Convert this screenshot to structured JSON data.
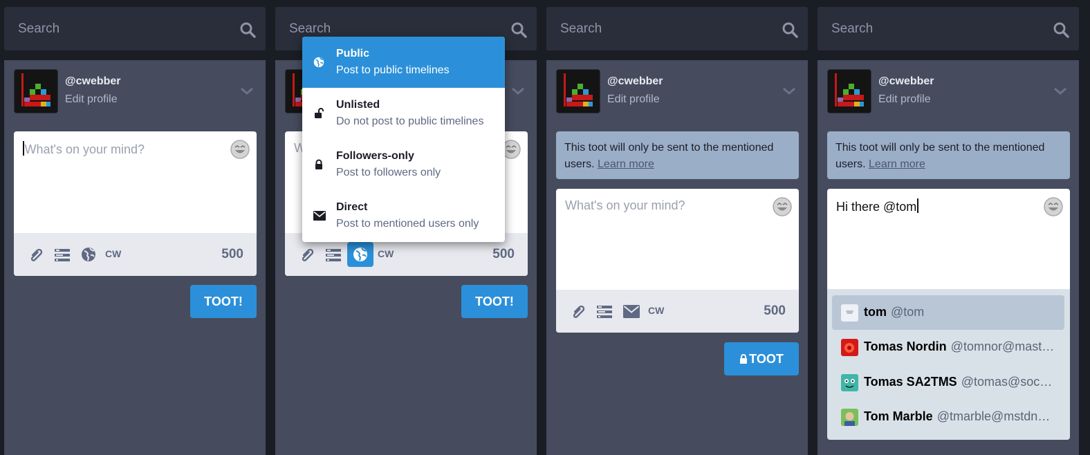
{
  "search": {
    "placeholder": "Search"
  },
  "profile": {
    "handle": "@cwebber",
    "edit_label": "Edit profile"
  },
  "composer": {
    "placeholder": "What's on your mind?",
    "char_count": "500",
    "cw_label": "CW",
    "toot_label": "TOOT!",
    "toot_private_label": "TOOT",
    "typed_text": "Hi there @tom",
    "truncated_placeholder": "W"
  },
  "direct_warning": {
    "text": "This toot will only be sent to the mentioned users.",
    "link": "Learn more"
  },
  "privacy_menu": {
    "options": [
      {
        "title": "Public",
        "desc": "Post to public timelines",
        "icon": "globe-icon",
        "selected": true
      },
      {
        "title": "Unlisted",
        "desc": "Do not post to public timelines",
        "icon": "unlock-icon"
      },
      {
        "title": "Followers-only",
        "desc": "Post to followers only",
        "icon": "lock-icon"
      },
      {
        "title": "Direct",
        "desc": "Post to mentioned users only",
        "icon": "envelope-icon"
      }
    ]
  },
  "suggestions": [
    {
      "name": "tom",
      "acct": "@tom",
      "selected": true
    },
    {
      "name": "Tomas Nordin",
      "acct": "@tomnor@mast…"
    },
    {
      "name": "Tomas SA2TMS",
      "acct": "@tomas@soc…"
    },
    {
      "name": "Tom Marble",
      "acct": "@tmarble@mstdn…"
    }
  ],
  "colors": {
    "accent": "#2b90d9",
    "panel": "#464c5e",
    "search_bg": "#2a2e3a",
    "warning_bg": "#9baec8"
  }
}
